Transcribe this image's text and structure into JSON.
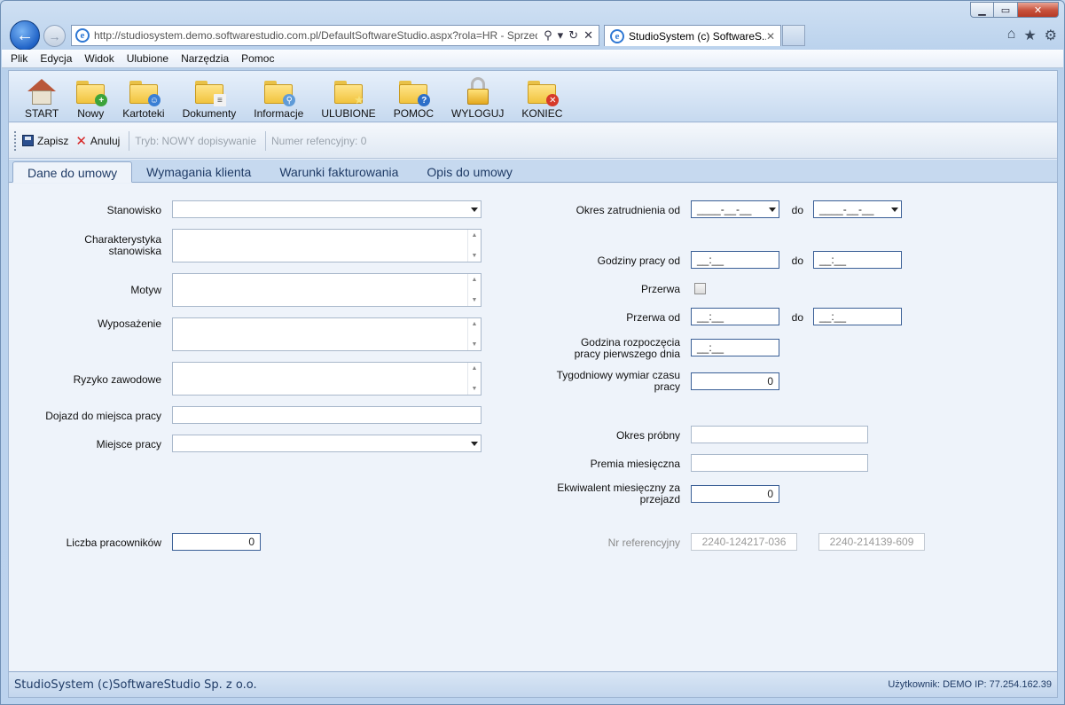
{
  "browser": {
    "address": "http://studiosystem.demo.softwarestudio.com.pl/DefaultSoftwareStudio.aspx?rola=HR - Sprzed",
    "tab_title": "StudioSystem (c) SoftwareS...",
    "menu": [
      "Plik",
      "Edycja",
      "Widok",
      "Ulubione",
      "Narzędzia",
      "Pomoc"
    ]
  },
  "toolbar": {
    "start": "START",
    "nowy": "Nowy",
    "kartoteki": "Kartoteki",
    "dokumenty": "Dokumenty",
    "informacje": "Informacje",
    "ulubione": "ULUBIONE",
    "pomoc": "POMOC",
    "wyloguj": "WYLOGUJ",
    "koniec": "KONIEC"
  },
  "actions": {
    "save": "Zapisz",
    "cancel": "Anuluj",
    "mode": "Tryb: NOWY dopisywanie",
    "ref": "Numer refencyjny:  0"
  },
  "tabs": [
    "Dane do umowy",
    "Wymagania klienta",
    "Warunki fakturowania",
    "Opis do umowy"
  ],
  "form": {
    "stanowisko": "Stanowisko",
    "charakterystyka": "Charakterystyka stanowiska",
    "motyw": "Motyw",
    "wyposazenie": "Wyposażenie",
    "ryzyko": "Ryzyko zawodowe",
    "dojazd": "Dojazd do miejsca pracy",
    "miejsce": "Miejsce pracy",
    "liczba": "Liczba pracowników",
    "liczba_value": "0",
    "okres_od": "Okres zatrudnienia od",
    "do": "do",
    "date_mask": "____-__-__",
    "godziny_od": "Godziny pracy od",
    "time_mask": "__:__",
    "przerwa": "Przerwa",
    "przerwa_od": "Przerwa od",
    "godzina_rozp": "Godzina rozpoczęcia pracy pierwszego dnia",
    "tygodniowy": "Tygodniowy wymiar czasu pracy",
    "tygodniowy_value": "0",
    "okres_probny": "Okres próbny",
    "premia": "Premia miesięczna",
    "ekwiwalent": "Ekwiwalent miesięczny za przejazd",
    "ekwiwalent_value": "0",
    "nr_ref": "Nr referencyjny",
    "nr_ref_1": "2240-124217-036",
    "nr_ref_2": "2240-214139-609"
  },
  "status": {
    "left": "StudioSystem (c)SoftwareStudio Sp. z o.o.",
    "right": "Użytkownik: DEMO IP: 77.254.162.39"
  }
}
